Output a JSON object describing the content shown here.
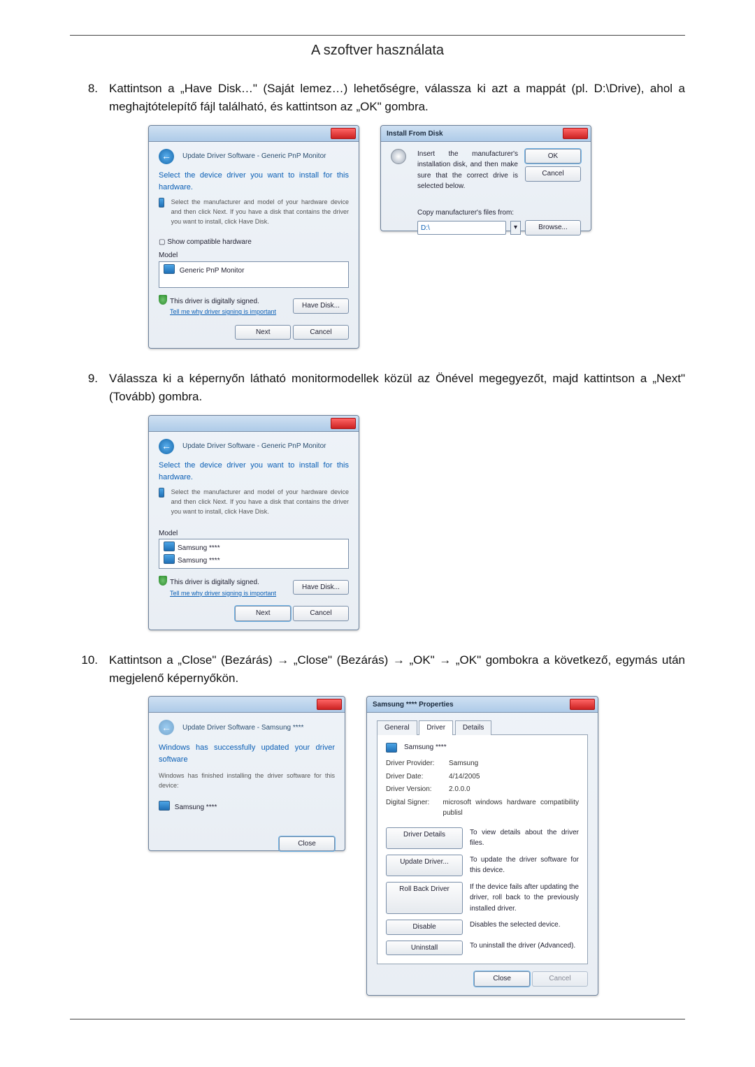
{
  "header": {
    "title": "A szoftver használata"
  },
  "step8": {
    "num": "8.",
    "text": "Kattintson a „Have Disk…\" (Saját lemez…) lehetőségre, válassza ki azt a mappát (pl. D:\\Drive), ahol a meghajtótelepítő fájl található, és kattintson az „OK\" gombra."
  },
  "step9": {
    "num": "9.",
    "text": "Válassza ki a képernyőn látható monitormodellek közül az Önével megegyezőt, majd kattintson a „Next\" (Tovább) gombra."
  },
  "step10": {
    "num": "10.",
    "text": "Kattintson a „Close\" (Bezárás) → „Close\" (Bezárás) → „OK\" → „OK\" gombokra a következő, egymás után megjelenő képernyőkön."
  },
  "dlgA": {
    "crumb": "Update Driver Software - Generic PnP Monitor",
    "heading": "Select the device driver you want to install for this hardware.",
    "desc": "Select the manufacturer and model of your hardware device and then click Next. If you have a disk that contains the driver you want to install, click Have Disk.",
    "compat": "Show compatible hardware",
    "model_label": "Model",
    "model_item": "Generic PnP Monitor",
    "signed": "This driver is digitally signed.",
    "signed_link": "Tell me why driver signing is important",
    "have_disk": "Have Disk...",
    "next": "Next",
    "cancel": "Cancel"
  },
  "dlgB": {
    "title": "Install From Disk",
    "msg": "Insert the manufacturer's installation disk, and then make sure that the correct drive is selected below.",
    "ok": "OK",
    "cancel": "Cancel",
    "copy_label": "Copy manufacturer's files from:",
    "path": "D:\\",
    "browse": "Browse..."
  },
  "dlgC": {
    "crumb": "Update Driver Software - Generic PnP Monitor",
    "heading": "Select the device driver you want to install for this hardware.",
    "desc": "Select the manufacturer and model of your hardware device and then click Next. If you have a disk that contains the driver you want to install, click Have Disk.",
    "model_label": "Model",
    "model1": "Samsung ****",
    "model2": "Samsung ****",
    "signed": "This driver is digitally signed.",
    "signed_link": "Tell me why driver signing is important",
    "have_disk": "Have Disk...",
    "next": "Next",
    "cancel": "Cancel"
  },
  "dlgD": {
    "crumb": "Update Driver Software - Samsung ****",
    "heading": "Windows has successfully updated your driver software",
    "sub": "Windows has finished installing the driver software for this device:",
    "device": "Samsung ****",
    "close": "Close"
  },
  "dlgE": {
    "title": "Samsung **** Properties",
    "tabs": {
      "general": "General",
      "driver": "Driver",
      "details": "Details"
    },
    "device": "Samsung ****",
    "rows": {
      "provider_k": "Driver Provider:",
      "provider_v": "Samsung",
      "date_k": "Driver Date:",
      "date_v": "4/14/2005",
      "version_k": "Driver Version:",
      "version_v": "2.0.0.0",
      "signer_k": "Digital Signer:",
      "signer_v": "microsoft windows hardware compatibility publisl"
    },
    "btns": {
      "details": "Driver Details",
      "details_d": "To view details about the driver files.",
      "update": "Update Driver...",
      "update_d": "To update the driver software for this device.",
      "rollback": "Roll Back Driver",
      "rollback_d": "If the device fails after updating the driver, roll back to the previously installed driver.",
      "disable": "Disable",
      "disable_d": "Disables the selected device.",
      "uninstall": "Uninstall",
      "uninstall_d": "To uninstall the driver (Advanced)."
    },
    "close": "Close",
    "cancel": "Cancel"
  }
}
